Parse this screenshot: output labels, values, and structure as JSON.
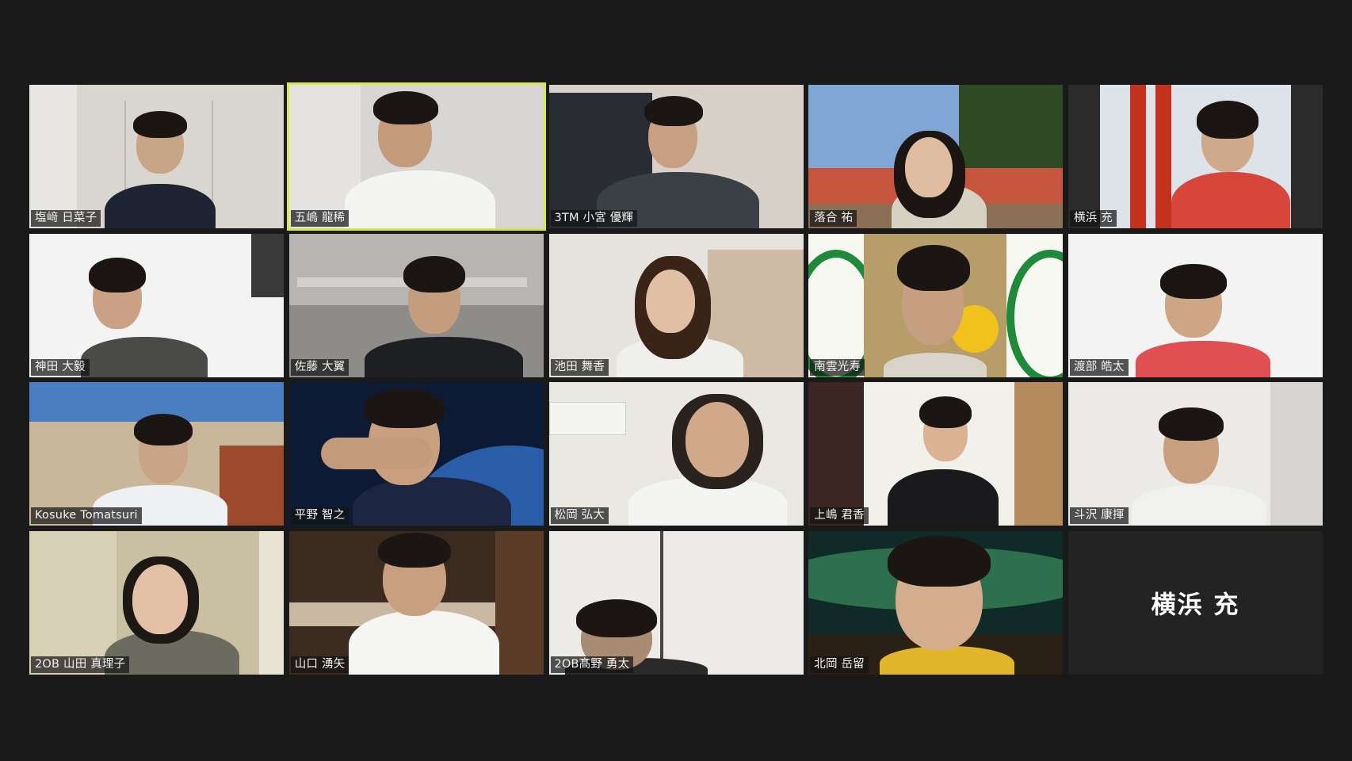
{
  "meeting": {
    "view": "gallery",
    "active_speaker": "五嶋 龍稀",
    "colors": {
      "background": "#1a1a1a",
      "active_border": "#d8e84a",
      "label_bg": "rgba(20,20,20,0.72)",
      "label_text": "#f2f2f2"
    }
  },
  "participants": [
    {
      "name": "塩﨑 日菜子",
      "video": true,
      "active": false
    },
    {
      "name": "五嶋 龍稀",
      "video": true,
      "active": true
    },
    {
      "name": "3TM 小宮 優輝",
      "video": true,
      "active": false
    },
    {
      "name": "落合 祐",
      "video": true,
      "active": false
    },
    {
      "name": "横浜 充",
      "video": true,
      "active": false
    },
    {
      "name": "神田 大毅",
      "video": true,
      "active": false
    },
    {
      "name": "佐藤 大翼",
      "video": true,
      "active": false
    },
    {
      "name": "池田 舞香",
      "video": true,
      "active": false
    },
    {
      "name": "南雲光寿",
      "video": true,
      "active": false
    },
    {
      "name": "渡部 皓太",
      "video": true,
      "active": false
    },
    {
      "name": "Kosuke Tomatsuri",
      "video": true,
      "active": false
    },
    {
      "name": "平野 智之",
      "video": true,
      "active": false
    },
    {
      "name": "松岡 弘大",
      "video": true,
      "active": false
    },
    {
      "name": "上嶋 君香",
      "video": true,
      "active": false
    },
    {
      "name": "斗沢 康揮",
      "video": true,
      "active": false
    },
    {
      "name": "2OB 山田 真理子",
      "video": true,
      "active": false
    },
    {
      "name": "山口 湧矢",
      "video": true,
      "active": false
    },
    {
      "name": "2OB髙野 勇太",
      "video": true,
      "active": false
    },
    {
      "name": "北岡 岳留",
      "video": true,
      "active": false
    },
    {
      "name": "横浜 充",
      "video": false,
      "active": false
    }
  ]
}
